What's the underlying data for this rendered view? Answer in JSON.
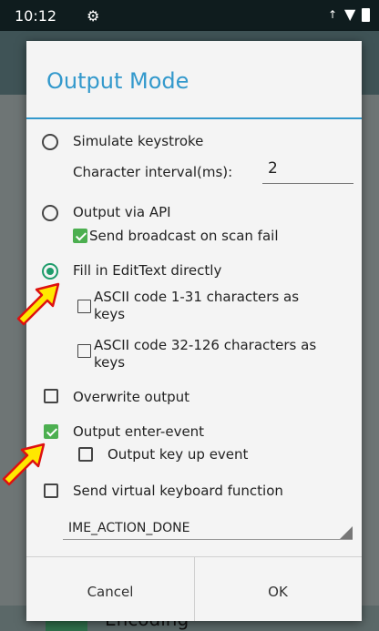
{
  "status_bar": {
    "time": "10:12",
    "gear_icon": "gear-icon",
    "signal": "↑",
    "wifi_icon": "wifi-icon",
    "battery_icon": "battery-icon"
  },
  "background": {
    "footer_label": "Encoding"
  },
  "dialog": {
    "title": "Output Mode",
    "options": {
      "simulate_keystroke": "Simulate keystroke",
      "char_interval_label": "Character interval(ms):",
      "char_interval_value": "2",
      "output_via_api": "Output via API",
      "send_broadcast": "Send broadcast on scan fail",
      "fill_edittext": "Fill in EditText directly",
      "ascii_1_31_line1": "ASCII code 1-31 characters as",
      "ascii_1_31_line2": "keys",
      "ascii_32_126_line1": "ASCII code 32-126 characters as",
      "ascii_32_126_line2": "keys",
      "overwrite_output": "Overwrite output",
      "output_enter_event": "Output enter-event",
      "output_key_up": "Output key up event",
      "send_virtual_keyboard": "Send virtual keyboard function",
      "ime_action": "IME_ACTION_DONE"
    },
    "states": {
      "simulate_keystroke": false,
      "output_via_api": false,
      "send_broadcast": true,
      "fill_edittext": true,
      "ascii_1_31": false,
      "ascii_32_126": false,
      "overwrite_output": false,
      "output_enter_event": true,
      "output_key_up": false,
      "send_virtual_keyboard": false
    },
    "buttons": {
      "cancel": "Cancel",
      "ok": "OK"
    },
    "accent_color": "#3399cc",
    "check_color": "#4caf50"
  }
}
